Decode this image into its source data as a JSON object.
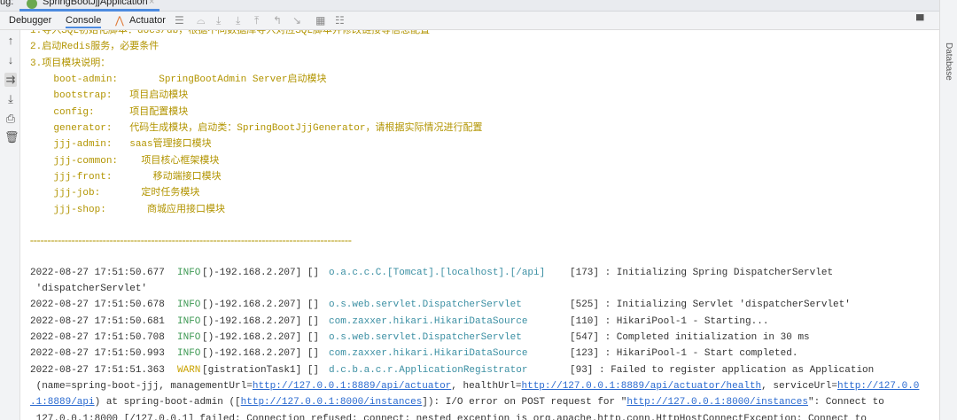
{
  "tabbar": {
    "prefix": "ug:",
    "tab": "SpringBootJjjApplication",
    "close": "×"
  },
  "toolbar": {
    "tabs": [
      "Debugger",
      "Console",
      "Actuator"
    ]
  },
  "right_strip": {
    "label": "Database"
  },
  "banner": [
    "1.导入SQL初始化脚本：docs/db，根据不同数据库导入对应SQL脚本并修改链接等信息配置",
    "2.启动Redis服务，必要条件",
    "3.项目模块说明：",
    "    boot-admin:       SpringBootAdmin Server启动模块",
    "    bootstrap:   项目启动模块",
    "    config:      项目配置模块",
    "    generator:   代码生成模块，启动类：SpringBootJjjGenerator，请根据实际情况进行配置",
    "    jjj-admin:   saas管理接口模块",
    "    jjj-common:    项目核心框架模块",
    "    jjj-front:       移动端接口模块",
    "    jjj-job:       定时任务模块",
    "    jjj-shop:       商城应用接口模块"
  ],
  "separator": "=============================================================================================",
  "logs": [
    {
      "ts": "2022-08-27 17:51:50.677",
      "level": "INFO",
      "thread": "[)-192.168.2.207] []",
      "logger": "o.a.c.c.C.[Tomcat].[localhost].[/api]",
      "msg": "[173] : Initializing Spring DispatcherServlet",
      "cont": " 'dispatcherServlet'"
    },
    {
      "ts": "2022-08-27 17:51:50.678",
      "level": "INFO",
      "thread": "[)-192.168.2.207] []",
      "logger": "o.s.web.servlet.DispatcherServlet",
      "msg": "[525] : Initializing Servlet 'dispatcherServlet'"
    },
    {
      "ts": "2022-08-27 17:51:50.681",
      "level": "INFO",
      "thread": "[)-192.168.2.207] []",
      "logger": "com.zaxxer.hikari.HikariDataSource",
      "msg": "[110] : HikariPool-1 - Starting..."
    },
    {
      "ts": "2022-08-27 17:51:50.708",
      "level": "INFO",
      "thread": "[)-192.168.2.207] []",
      "logger": "o.s.web.servlet.DispatcherServlet",
      "msg": "[547] : Completed initialization in 30 ms"
    },
    {
      "ts": "2022-08-27 17:51:50.993",
      "level": "INFO",
      "thread": "[)-192.168.2.207] []",
      "logger": "com.zaxxer.hikari.HikariDataSource",
      "msg": "[123] : HikariPool-1 - Start completed."
    },
    {
      "ts": "2022-08-27 17:51:51.363",
      "level": "WARN",
      "thread": "[gistrationTask1] []",
      "logger": "d.c.b.a.c.r.ApplicationRegistrator",
      "msg": "[93] : Failed to register application as Application"
    }
  ],
  "warn_cont": {
    "a": " (name=spring-boot-jjj, managementUrl=",
    "l1": "http://127.0.0.1:8889/api/actuator",
    "b": ", healthUrl=",
    "l2": "http://127.0.0.1:8889/api/actuator/health",
    "c": ", serviceUrl=",
    "l3": "http://127.0.0",
    "l3b": ".1:8889/api",
    "d": ") at spring-boot-admin ([",
    "l4": "http://127.0.0.1:8000/instances",
    "e": "]): I/O error on POST request for \"",
    "l5": "http://127.0.0.1:8000/instances",
    "f": "\": Connect to",
    "g": " 127.0.0.1:8000 [/127.0.0.1] failed: Connection refused: connect; nested exception is org.apache.http.conn.HttpHostConnectException: Connect to"
  },
  "colors": {
    "banner": "#b29400",
    "info": "#3f9a55",
    "warn": "#c9a200",
    "logger": "#3b8fa3",
    "link": "#2a6ad0"
  }
}
